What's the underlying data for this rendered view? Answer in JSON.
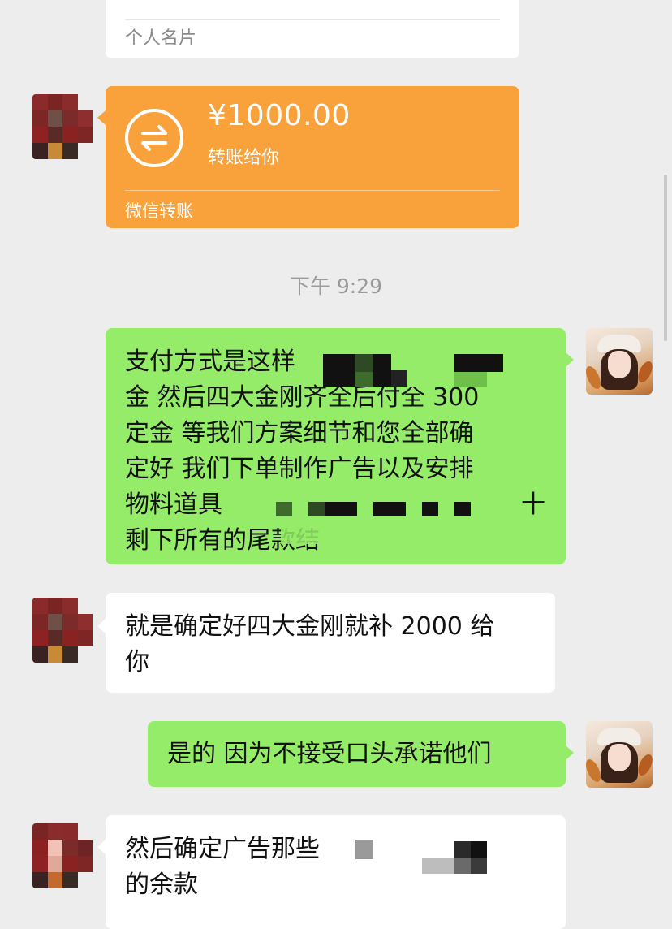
{
  "business_card": {
    "label": "个人名片"
  },
  "transfer": {
    "amount": "¥1000.00",
    "subtitle": "转账给你",
    "footer": "微信转账",
    "icon": "transfer-arrows-icon"
  },
  "timestamp": "下午 9:29",
  "messages": [
    {
      "side": "right",
      "lines": [
        "支付方式是这样",
        "金 然后四大金刚齐全后付全 300",
        "定金  等我们方案细节和您全部确",
        "定好 我们下单制作广告以及安排",
        "物料道具",
        " 剩下所有的尾款结",
        "十"
      ]
    },
    {
      "side": "left",
      "lines": [
        "就是确定好四大金刚就补 2000 给",
        "你"
      ]
    },
    {
      "side": "right",
      "lines": [
        "是的  因为不接受口头承诺他们"
      ]
    },
    {
      "side": "left",
      "lines": [
        "然后确定广告那些",
        "的余款"
      ]
    }
  ]
}
